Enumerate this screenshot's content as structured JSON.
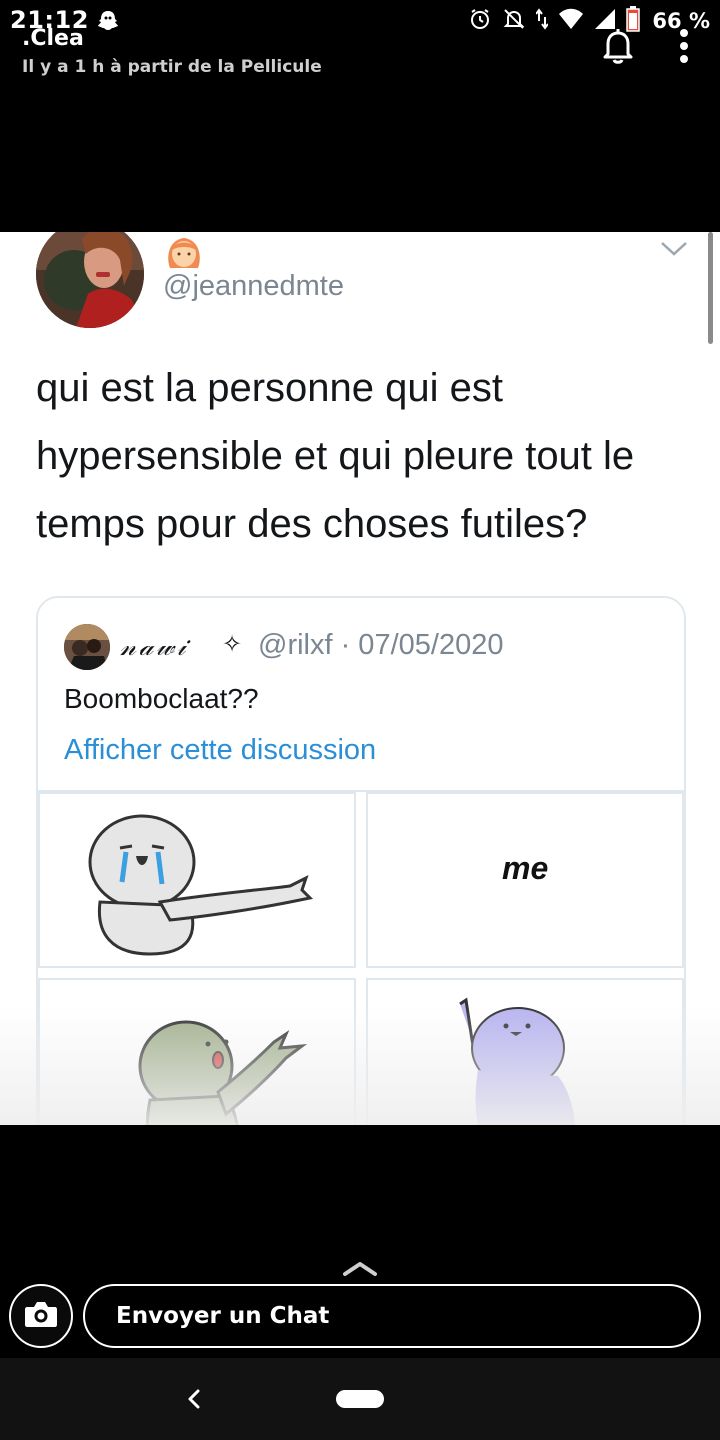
{
  "status": {
    "time": "21:12",
    "battery": "66 %",
    "icons": [
      "snapchat-ghost-icon",
      "alarm-icon",
      "notifications-off-icon",
      "data-arrows-icon",
      "wifi-icon",
      "signal-icon",
      "battery-icon"
    ]
  },
  "header": {
    "username": ".Clea",
    "subtitle": "Il y a 1 h à partir de la Pellicule",
    "icons": [
      "bell-icon",
      "more-vertical-icon"
    ]
  },
  "tweet": {
    "handle": "@jeannedmte",
    "emoji": "person-emoji",
    "text": "qui est la personne qui est hypersensible et qui pleure tout le temps pour des choses futiles?",
    "quoted": {
      "name": "𝓃𝒶𝓌𝒾",
      "star": "✧",
      "handle_date": "@rilxf · 07/05/2020",
      "body": "Boomboclaat??",
      "link": "Afficher cette discussion",
      "grid_caption": "me"
    }
  },
  "chat": {
    "placeholder": "Envoyer un Chat"
  },
  "colors": {
    "link": "#2b8fd8",
    "muted": "#7a8692",
    "tweet_text": "#14171a"
  }
}
